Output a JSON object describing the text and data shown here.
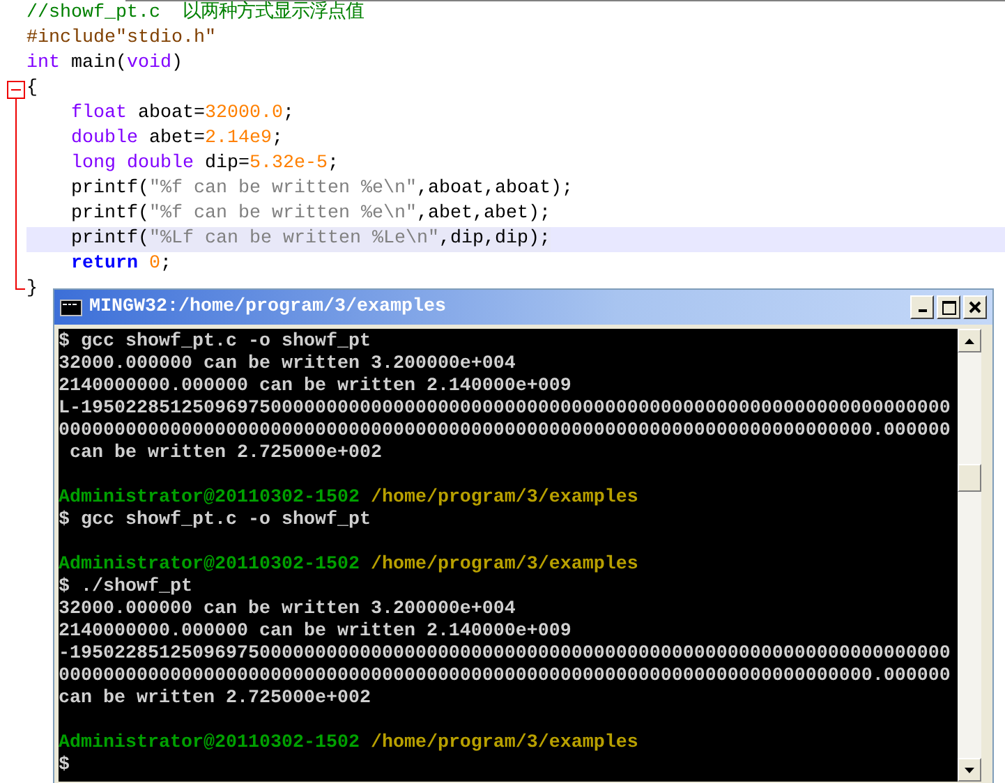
{
  "editor": {
    "lines": [
      {
        "segments": [
          {
            "kind": "comment",
            "text": "//showf_pt.c  以两种方式显示浮点值"
          }
        ]
      },
      {
        "segments": [
          {
            "kind": "preprocessor",
            "text": "#include\"stdio.h\""
          }
        ]
      },
      {
        "segments": [
          {
            "kind": "type",
            "text": "int"
          },
          {
            "kind": "plain",
            "text": " main("
          },
          {
            "kind": "type",
            "text": "void"
          },
          {
            "kind": "plain",
            "text": ")"
          }
        ]
      },
      {
        "expanded": true,
        "segments": [
          {
            "kind": "plain",
            "text": "{"
          }
        ],
        "children": [
          {
            "highlighted": false,
            "segments": [
              {
                "kind": "type",
                "text": "float"
              },
              {
                "kind": "plain",
                "text": " aboat="
              },
              {
                "kind": "number",
                "text": "32000.0"
              },
              {
                "kind": "plain",
                "text": ";"
              }
            ]
          },
          {
            "highlighted": false,
            "segments": [
              {
                "kind": "type",
                "text": "double"
              },
              {
                "kind": "plain",
                "text": " abet="
              },
              {
                "kind": "number",
                "text": "2.14e9"
              },
              {
                "kind": "plain",
                "text": ";"
              }
            ]
          },
          {
            "highlighted": false,
            "segments": [
              {
                "kind": "type",
                "text": "long"
              },
              {
                "kind": "type",
                "text": " double"
              },
              {
                "kind": "plain",
                "text": " dip="
              },
              {
                "kind": "number",
                "text": "5.32e-5"
              },
              {
                "kind": "plain",
                "text": ";"
              }
            ]
          },
          {
            "highlighted": false,
            "segments": [
              {
                "kind": "plain",
                "text": "printf("
              },
              {
                "kind": "string",
                "text": "\"%f can be written %e\\n\""
              },
              {
                "kind": "plain",
                "text": ",aboat,aboat);"
              }
            ]
          },
          {
            "highlighted": false,
            "segments": [
              {
                "kind": "plain",
                "text": "printf("
              },
              {
                "kind": "string",
                "text": "\"%f can be written %e\\n\""
              },
              {
                "kind": "plain",
                "text": ",abet,abet);"
              }
            ]
          },
          {
            "highlighted": true,
            "segments": [
              {
                "kind": "plain",
                "text": "printf("
              },
              {
                "kind": "string",
                "text": "\"%Lf can be written %Le\\n\""
              },
              {
                "kind": "plain",
                "text": ",dip,dip);"
              }
            ]
          },
          {
            "highlighted": false,
            "segments": [
              {
                "kind": "keyword",
                "text": "return"
              },
              {
                "kind": "number",
                "text": " 0"
              },
              {
                "kind": "plain",
                "text": ";"
              }
            ]
          }
        ]
      },
      {
        "segments": [
          {
            "kind": "plain",
            "text": "}"
          }
        ]
      }
    ]
  },
  "terminal": {
    "title": "MINGW32:/home/program/3/examples",
    "blocks": [
      [
        [
          {
            "kind": "output",
            "text": "$ gcc showf_pt.c -o showf_pt"
          }
        ],
        [
          {
            "kind": "output",
            "text": "32000.000000 can be written 3.200000e+004"
          }
        ],
        [
          {
            "kind": "output",
            "text": "2140000000.000000 can be written 2.140000e+009"
          }
        ],
        [
          {
            "kind": "output",
            "text": "L-195022851250969750000000000000000000000000000000000000000000000000000000000000"
          }
        ],
        [
          {
            "kind": "output",
            "text": "0000000000000000000000000000000000000000000000000000000000000000000000000.000000"
          }
        ],
        [
          {
            "kind": "output",
            "text": " can be written 2.725000e+002"
          }
        ]
      ],
      [
        [
          {
            "kind": "user",
            "text": "Administrator@20110302-1502"
          },
          {
            "kind": "path",
            "text": " /home/program/3/examples"
          }
        ],
        [
          {
            "kind": "output",
            "text": "$ gcc showf_pt.c -o showf_pt"
          }
        ]
      ],
      [
        [
          {
            "kind": "user",
            "text": "Administrator@20110302-1502"
          },
          {
            "kind": "path",
            "text": " /home/program/3/examples"
          }
        ],
        [
          {
            "kind": "output",
            "text": "$ ./showf_pt"
          }
        ],
        [
          {
            "kind": "output",
            "text": "32000.000000 can be written 3.200000e+004"
          }
        ],
        [
          {
            "kind": "output",
            "text": "2140000000.000000 can be written 2.140000e+009"
          }
        ],
        [
          {
            "kind": "output",
            "text": "-1950228512509697500000000000000000000000000000000000000000000000000000000000000"
          }
        ],
        [
          {
            "kind": "output",
            "text": "0000000000000000000000000000000000000000000000000000000000000000000000000.000000"
          }
        ],
        [
          {
            "kind": "output",
            "text": "can be written 2.725000e+002"
          }
        ]
      ],
      [
        [
          {
            "kind": "user",
            "text": "Administrator@20110302-1502"
          },
          {
            "kind": "path",
            "text": " /home/program/3/examples"
          }
        ],
        [
          {
            "kind": "output",
            "text": "$"
          }
        ]
      ]
    ]
  }
}
